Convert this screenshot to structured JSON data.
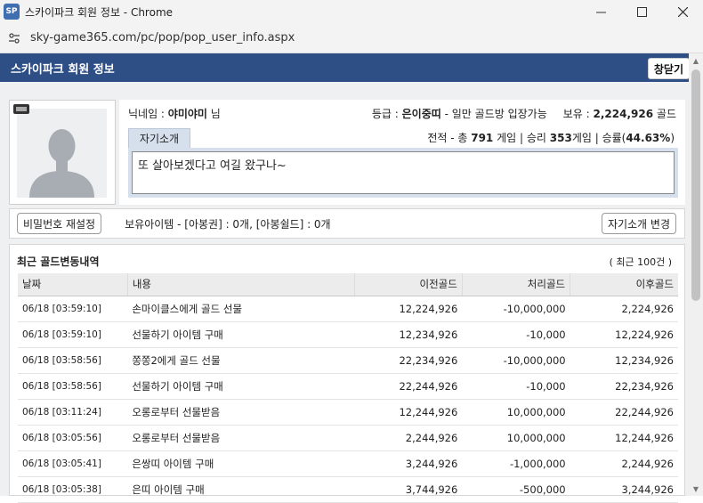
{
  "window": {
    "icon_text": "SP",
    "title": "스카이파크 회원 정보 - Chrome",
    "url": "sky-game365.com/pc/pop/pop_user_info.aspx"
  },
  "header": {
    "title": "스카이파크 회원 정보",
    "close_label": "창닫기"
  },
  "profile": {
    "nick_label": "닉네임 : ",
    "nick_value": "야미야미",
    "nick_suffix": " 님",
    "grade_label": "등급 : ",
    "grade_value": "은이중띠",
    "grade_desc": " - 일만 골드방 입장가능",
    "gold_label": "보유 : ",
    "gold_value": "2,224,926",
    "gold_unit": " 골드",
    "intro_tab": "자기소개",
    "record_prefix": "전적 - 총 ",
    "total_games": "791",
    "record_games_label": " 게임 | 승리 ",
    "wins": "353",
    "record_win_label": "게임 | 승률(",
    "win_rate": "44.63%",
    "record_close": ")",
    "intro_text": "또 살아보겠다고 여길 왔구나~"
  },
  "actions": {
    "password_reset": "비밀번호 재설정",
    "items": "보유아이템 - [아봉권] : 0개, [아봉쉴드] : 0개",
    "edit_intro": "자기소개 변경"
  },
  "history": {
    "title": "최근 골드변동내역",
    "count": "( 최근 100건 )",
    "columns": [
      "날짜",
      "내용",
      "이전골드",
      "처리골드",
      "이후골드"
    ],
    "rows": [
      [
        "06/18 [03:59:10]",
        "손마이클스에게 골드 선물",
        "12,224,926",
        "-10,000,000",
        "2,224,926"
      ],
      [
        "06/18 [03:59:10]",
        "선물하기 아이템 구매",
        "12,234,926",
        "-10,000",
        "12,224,926"
      ],
      [
        "06/18 [03:58:56]",
        "쫑쫑2에게 골드 선물",
        "22,234,926",
        "-10,000,000",
        "12,234,926"
      ],
      [
        "06/18 [03:58:56]",
        "선물하기 아이템 구매",
        "22,244,926",
        "-10,000",
        "22,234,926"
      ],
      [
        "06/18 [03:11:24]",
        "오롱로부터 선물받음",
        "12,244,926",
        "10,000,000",
        "22,244,926"
      ],
      [
        "06/18 [03:05:56]",
        "오롱로부터 선물받음",
        "2,244,926",
        "10,000,000",
        "12,244,926"
      ],
      [
        "06/18 [03:05:41]",
        "은쌍띠 아이템 구매",
        "3,244,926",
        "-1,000,000",
        "2,244,926"
      ],
      [
        "06/18 [03:05:38]",
        "은띠 아이템 구매",
        "3,744,926",
        "-500,000",
        "3,244,926"
      ]
    ]
  },
  "colors": {
    "header_bg": "#2e4f85",
    "tab_bg": "#d6e0ec"
  }
}
